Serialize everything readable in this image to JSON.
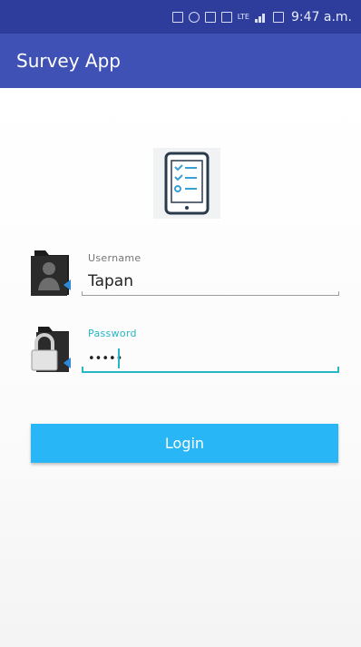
{
  "status_bar": {
    "time": "9:47 a.m.",
    "lte_label": "LTE"
  },
  "app_bar": {
    "title": "Survey App"
  },
  "form": {
    "username": {
      "label": "Username",
      "value": "Tapan"
    },
    "password": {
      "label": "Password",
      "value": "••••••"
    },
    "login_label": "Login"
  },
  "colors": {
    "status_bar": "#2e3d9c",
    "app_bar": "#3f51b5",
    "accent": "#26b6c4",
    "button": "#29b6f6"
  },
  "icons": [
    "survey-tablet-icon",
    "user-folder-icon",
    "lock-folder-icon"
  ]
}
